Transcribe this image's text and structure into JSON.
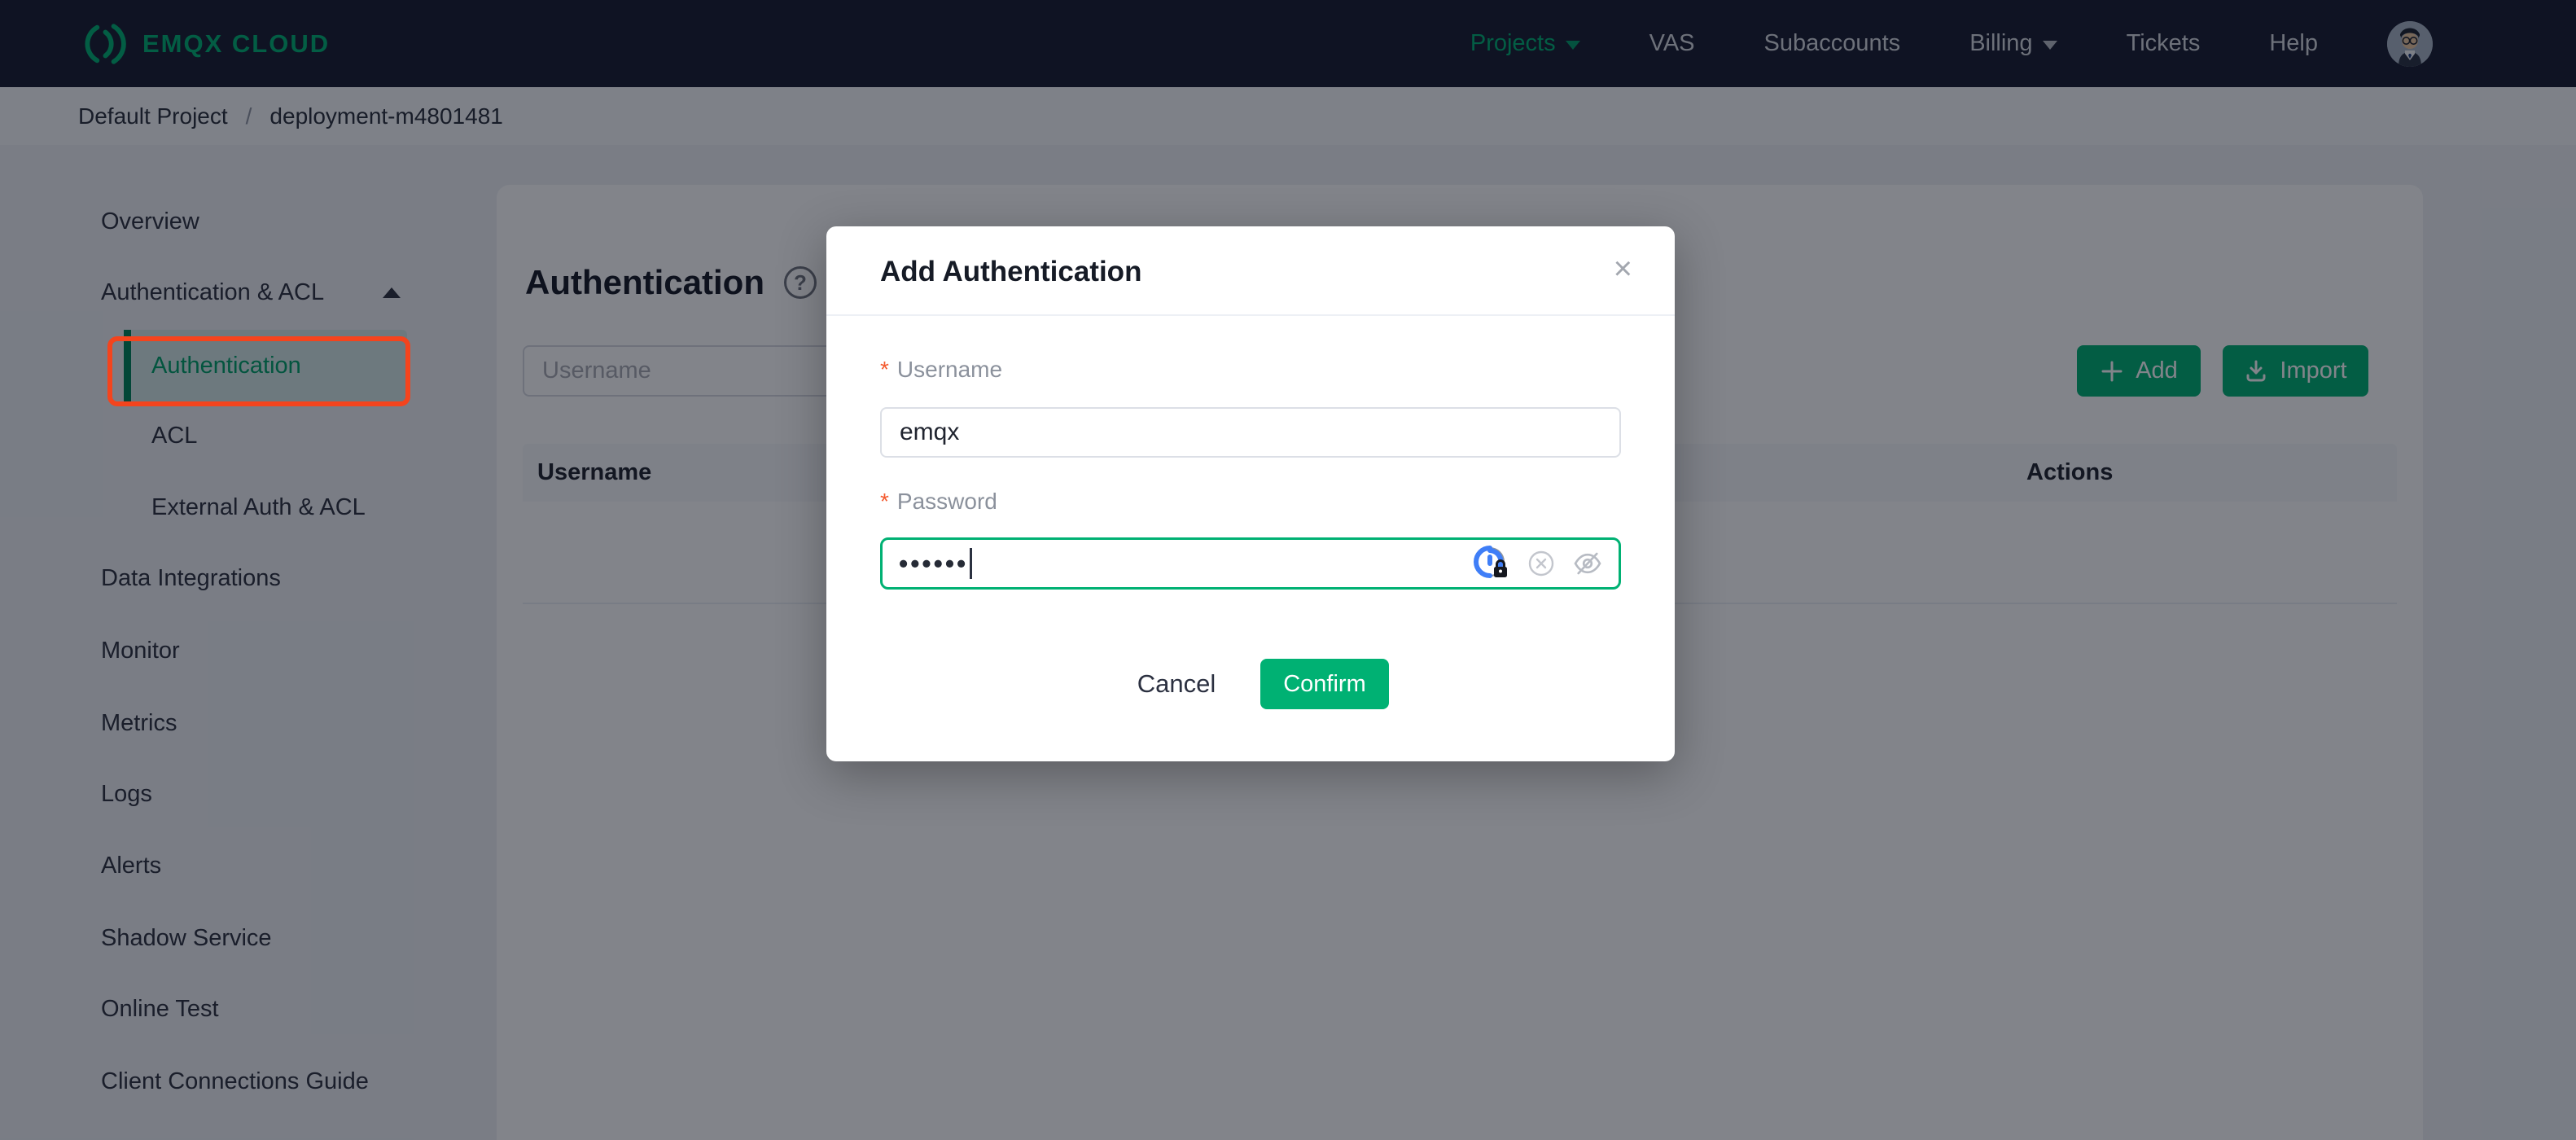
{
  "navbar": {
    "brand": "EMQX CLOUD",
    "items": [
      {
        "label": "Projects",
        "active": true,
        "has_caret": true
      },
      {
        "label": "VAS"
      },
      {
        "label": "Subaccounts"
      },
      {
        "label": "Billing",
        "has_caret": true
      },
      {
        "label": "Tickets"
      },
      {
        "label": "Help"
      }
    ]
  },
  "breadcrumb": {
    "project": "Default Project",
    "separator": "/",
    "deployment": "deployment-m4801481"
  },
  "sidebar": {
    "items": [
      {
        "label": "Overview"
      },
      {
        "label": "Authentication & ACL",
        "expanded": true
      },
      {
        "label": "Authentication",
        "active": true
      },
      {
        "label": "ACL"
      },
      {
        "label": "External Auth & ACL"
      },
      {
        "label": "Data Integrations"
      },
      {
        "label": "Monitor"
      },
      {
        "label": "Metrics"
      },
      {
        "label": "Logs"
      },
      {
        "label": "Alerts"
      },
      {
        "label": "Shadow Service"
      },
      {
        "label": "Online Test"
      },
      {
        "label": "Client Connections Guide"
      }
    ]
  },
  "main": {
    "title": "Authentication",
    "help_icon": "?",
    "search": {
      "placeholder": "Username",
      "value": ""
    },
    "add_label": "Add",
    "import_label": "Import",
    "table": {
      "columns": [
        "Username",
        "Actions"
      ]
    }
  },
  "modal": {
    "title": "Add Authentication",
    "close_icon": "×",
    "username_label": "Username",
    "username_value": "emqx",
    "password_label": "Password",
    "password_masked": "••••••",
    "required_mark": "*",
    "cancel_label": "Cancel",
    "confirm_label": "Confirm"
  },
  "colors": {
    "brand_green": "#00b173",
    "navbar_bg": "#191d30",
    "annotation_red": "#f4441d",
    "required_red": "#f45a2e",
    "dim_overlay": "rgba(5,10,22,0.5)"
  }
}
